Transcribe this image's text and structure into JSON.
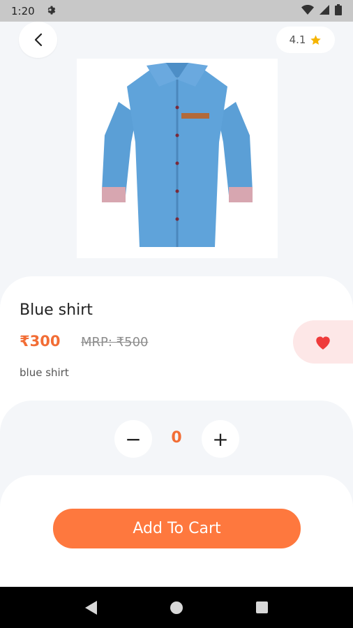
{
  "status_bar": {
    "time": "1:20"
  },
  "header": {
    "rating": "4.1"
  },
  "product": {
    "name": "Blue shirt",
    "price": "₹300",
    "mrp": "MRP: ₹500",
    "description": "blue shirt"
  },
  "quantity": {
    "value": "0",
    "minus_label": "−",
    "plus_label": "+"
  },
  "cart": {
    "button_label": "Add To Cart"
  },
  "colors": {
    "accent": "#f26d35",
    "button": "#fe783e",
    "fav_bg": "#fde7e7",
    "heart": "#ef3b3b",
    "star": "#f5b400"
  }
}
